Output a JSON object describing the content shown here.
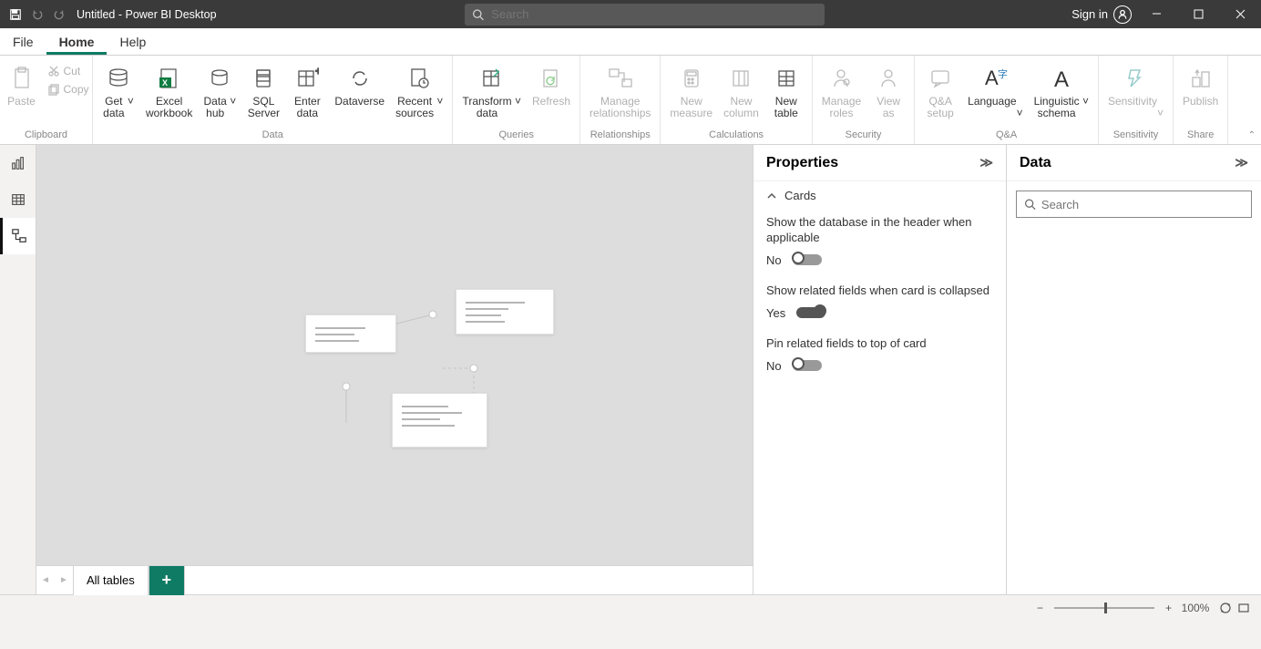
{
  "titlebar": {
    "title": "Untitled - Power BI Desktop",
    "search_placeholder": "Search",
    "signin": "Sign in"
  },
  "menu": {
    "file": "File",
    "home": "Home",
    "help": "Help"
  },
  "ribbon": {
    "clipboard": {
      "label": "Clipboard",
      "paste": "Paste",
      "cut": "Cut",
      "copy": "Copy"
    },
    "data": {
      "label": "Data",
      "get_data": "Get\ndata",
      "excel": "Excel\nworkbook",
      "data_hub": "Data\nhub",
      "sql": "SQL\nServer",
      "enter": "Enter\ndata",
      "dataverse": "Dataverse",
      "recent": "Recent\nsources"
    },
    "queries": {
      "label": "Queries",
      "transform": "Transform\ndata",
      "refresh": "Refresh"
    },
    "relationships": {
      "label": "Relationships",
      "manage": "Manage\nrelationships"
    },
    "calculations": {
      "label": "Calculations",
      "measure": "New\nmeasure",
      "column": "New\ncolumn",
      "table": "New\ntable"
    },
    "security": {
      "label": "Security",
      "roles": "Manage\nroles",
      "view_as": "View\nas"
    },
    "qa": {
      "label": "Q&A",
      "setup": "Q&A\nsetup",
      "language": "Language",
      "schema": "Linguistic\nschema"
    },
    "sensitivity": {
      "label": "Sensitivity",
      "btn": "Sensitivity"
    },
    "share": {
      "label": "Share",
      "publish": "Publish"
    }
  },
  "tabs": {
    "all_tables": "All tables"
  },
  "properties": {
    "title": "Properties",
    "section": "Cards",
    "opt1_label": "Show the database in the header when applicable",
    "opt1_value": "No",
    "opt2_label": "Show related fields when card is collapsed",
    "opt2_value": "Yes",
    "opt3_label": "Pin related fields to top of card",
    "opt3_value": "No"
  },
  "data_panel": {
    "title": "Data",
    "search_placeholder": "Search"
  },
  "status": {
    "zoom": "100%"
  }
}
